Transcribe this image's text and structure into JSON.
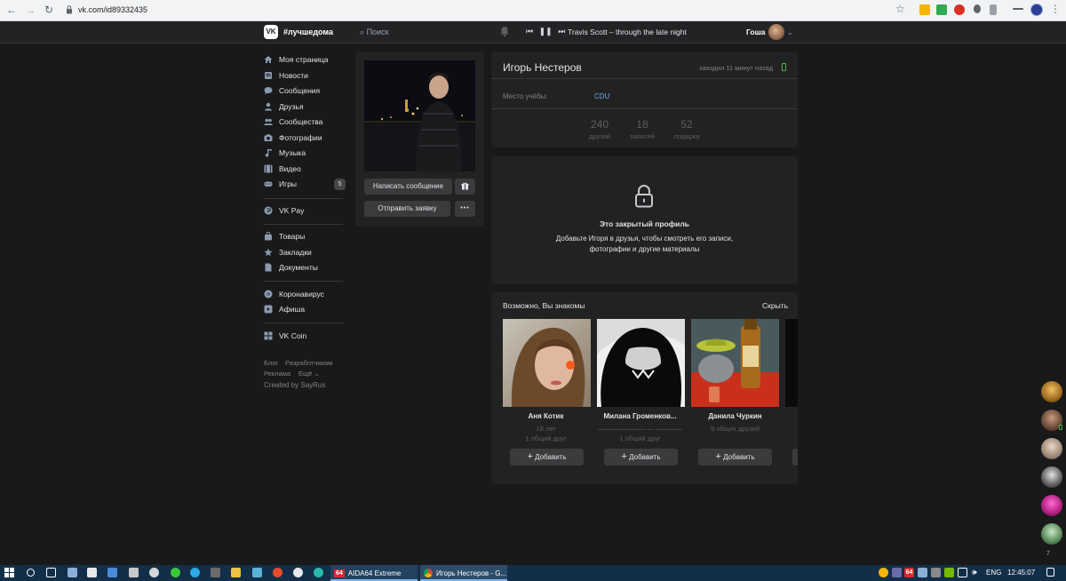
{
  "browser": {
    "url": "vk.com/id89332435",
    "tabs_apps": [
      "AIDA64 Extreme",
      "Игорь Нестеров - G..."
    ]
  },
  "header": {
    "logo": "VK",
    "hashtag": "#лучшедома",
    "search_placeholder": "Поиск",
    "track": "Travis Scott – through the late night",
    "user_name": "Гоша"
  },
  "menu": {
    "items": [
      {
        "label": "Моя страница",
        "icon": "home-icon"
      },
      {
        "label": "Новости",
        "icon": "news-icon"
      },
      {
        "label": "Сообщения",
        "icon": "messages-icon"
      },
      {
        "label": "Друзья",
        "icon": "friends-icon"
      },
      {
        "label": "Сообщества",
        "icon": "groups-icon"
      },
      {
        "label": "Фотографии",
        "icon": "camera-icon"
      },
      {
        "label": "Музыка",
        "icon": "music-icon"
      },
      {
        "label": "Видео",
        "icon": "video-icon"
      },
      {
        "label": "Игры",
        "icon": "games-icon"
      },
      {
        "label": "VK Pay",
        "icon": "vkpay-icon"
      },
      {
        "label": "Товары",
        "icon": "market-icon"
      },
      {
        "label": "Закладки",
        "icon": "bookmark-icon"
      },
      {
        "label": "Документы",
        "icon": "docs-icon"
      },
      {
        "label": "Коронавирус",
        "icon": "virus-icon"
      },
      {
        "label": "Афиша",
        "icon": "afisha-icon"
      },
      {
        "label": "VK Coin",
        "icon": "coin-icon"
      }
    ],
    "games_badge": "5",
    "footer": {
      "blog": "Блог",
      "developers": "Разработчикам",
      "ads": "Реклама",
      "more": "Ещё",
      "credit": "Created by SayRus"
    }
  },
  "profile": {
    "name": "Игорь Нестеров",
    "last_seen": "заходил 11 минут назад",
    "study_label": "Место учёбы:",
    "study_value": "CDU",
    "counters": [
      {
        "num": "240",
        "label": "друзей"
      },
      {
        "num": "18",
        "label": "записей"
      },
      {
        "num": "52",
        "label": "подарка"
      }
    ],
    "write_button": "Написать сообщение",
    "request_button": "Отправить заявку",
    "more_button": "•••"
  },
  "closed": {
    "title": "Это закрытый профиль",
    "text_line1": "Добавьте Игоря в друзья, чтобы смотреть его записи,",
    "text_line2": "фотографии и другие материалы"
  },
  "suggestions": {
    "title": "Возможно, Вы знакомы",
    "hide": "Скрыть",
    "add_label": "Добавить",
    "people": [
      {
        "name": "Аня Котик",
        "line1": "18 лет",
        "line2": "1 общий друг"
      },
      {
        "name": "Милана Громенков...",
        "line1": "——————— — ————",
        "line2": "1 общий друг"
      },
      {
        "name": "Данила Чуркин",
        "line1": "9 общих друзей",
        "line2": ""
      }
    ]
  },
  "side": {
    "count": "7"
  },
  "taskbar": {
    "lang": "ENG",
    "time": "12:45:07",
    "aida_badge": "64"
  }
}
